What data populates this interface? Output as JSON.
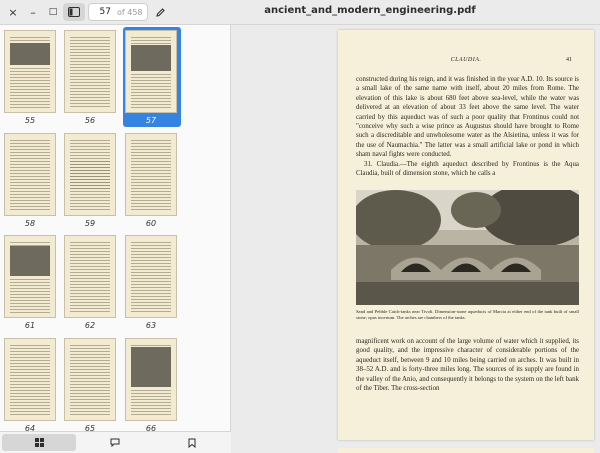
{
  "header": {
    "close_icon": "×",
    "minimize_icon": "–",
    "maximize_icon": "□",
    "current_page": "57",
    "page_of": "of 458",
    "title": "ancient_and_modern_engineering.pdf"
  },
  "sidebar": {
    "thumbnails": [
      {
        "label": "55",
        "selected": false
      },
      {
        "label": "56",
        "selected": false
      },
      {
        "label": "57",
        "selected": true
      },
      {
        "label": "58",
        "selected": false
      },
      {
        "label": "59",
        "selected": false
      },
      {
        "label": "60",
        "selected": false
      },
      {
        "label": "61",
        "selected": false
      },
      {
        "label": "62",
        "selected": false
      },
      {
        "label": "63",
        "selected": false
      },
      {
        "label": "64",
        "selected": false
      },
      {
        "label": "65",
        "selected": false
      },
      {
        "label": "66",
        "selected": false
      }
    ],
    "tabs": [
      {
        "name": "thumbnails-tab",
        "icon": "grid-icon",
        "active": true
      },
      {
        "name": "annotations-tab",
        "icon": "comment-icon",
        "active": false
      },
      {
        "name": "bookmarks-tab",
        "icon": "bookmark-icon",
        "active": false
      }
    ]
  },
  "document": {
    "running_title": "CLAUDIA.",
    "page_number": "41",
    "paragraph_top_1": "constructed during his reign, and it was finished in the year A.D. 10. Its source is a small lake of the same name with itself, about 20 miles from Rome. The elevation of this lake is about 680 feet above sea-level, while the water was delivered at an elevation of about 33 feet above the same level. The water carried by this aqueduct was of such a poor quality that Frontinus could not \"conceive why such a wise prince as Augustus should have brought to Rome such a discreditable and unwholesome water as the Alsietina, unless it was for the use of Naumachia.\" The latter was a small artificial lake or pond in which sham naval fights were conducted.",
    "paragraph_top_2": "31. Claudia.—The eighth aqueduct described by Frontinus is the Aqua Claudia, built of dimension stone, which he calls a",
    "caption": "Sand and Pebble Catch-tanks near Tivoli. Dimension-stone aqueducts of Marcia at either end of the tank built of small stone; opus incertum. The arches are chambers of the tanks.",
    "paragraph_bottom": "magnificent work on account of the large volume of water which it supplied, its good quality, and the impressive character of considerable portions of the aqueduct itself, between 9 and 10 miles being carried on arches. It was built in 38–52 A.D. and is forty-three miles long. The sources of its supply are found in the valley of the Anio, and consequently it belongs to the system on the left bank of the Tiber. The cross-section"
  },
  "colors": {
    "accent": "#3584e4",
    "page": "#f6efd9",
    "sidebar": "#fafafa"
  }
}
